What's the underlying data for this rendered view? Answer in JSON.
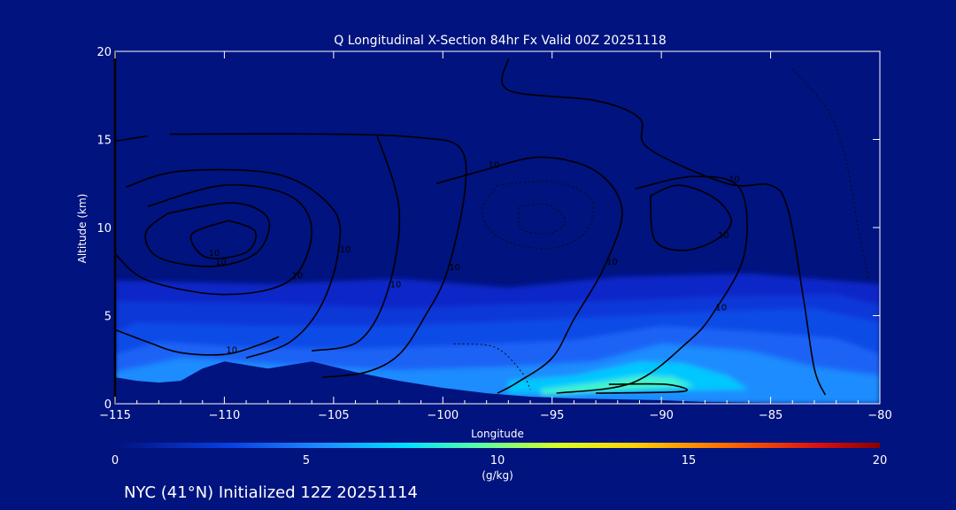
{
  "chart_data": {
    "type": "heatmap",
    "title": "Q Longitudinal X-Section 84hr  Fx Valid 00Z 20251118",
    "xlabel": "Longitude",
    "ylabel": "Altitude (km)",
    "xlim": [
      -115,
      -80
    ],
    "ylim": [
      0,
      20
    ],
    "x_ticks": [
      -115,
      -110,
      -105,
      -100,
      -95,
      -90,
      -85,
      -80
    ],
    "x_tick_labels": [
      "−115",
      "−110",
      "−105",
      "−100",
      "−95",
      "−90",
      "−85",
      "−80"
    ],
    "y_ticks": [
      0,
      5,
      10,
      15,
      20
    ],
    "y_tick_labels": [
      "0",
      "5",
      "10",
      "15",
      "20"
    ],
    "grid": false,
    "colorbar": {
      "min": 0,
      "max": 20,
      "ticks": [
        0,
        5,
        10,
        15,
        20
      ],
      "tick_labels": [
        "0",
        "5",
        "10",
        "15",
        "20"
      ],
      "unit_label": "(g/kg)"
    },
    "fill_regions": [
      {
        "q": 1.5,
        "points": [
          [
            -115,
            7
          ],
          [
            -108,
            6.8
          ],
          [
            -102,
            7.1
          ],
          [
            -97,
            6.6
          ],
          [
            -92,
            7.2
          ],
          [
            -86,
            7.4
          ],
          [
            -80,
            6.8
          ],
          [
            -80,
            0
          ],
          [
            -115,
            0
          ]
        ]
      },
      {
        "q": 2.5,
        "points": [
          [
            -115,
            5.8
          ],
          [
            -108,
            5.7
          ],
          [
            -102,
            5.4
          ],
          [
            -98,
            5.6
          ],
          [
            -93,
            5.8
          ],
          [
            -87,
            6.1
          ],
          [
            -82,
            6.2
          ],
          [
            -80,
            5.6
          ],
          [
            -80,
            0
          ],
          [
            -115,
            0
          ]
        ]
      },
      {
        "q": 3.5,
        "points": [
          [
            -114,
            4.6
          ],
          [
            -108,
            4.4
          ],
          [
            -103,
            4.4
          ],
          [
            -98,
            4.6
          ],
          [
            -93,
            4.9
          ],
          [
            -88,
            5.2
          ],
          [
            -83,
            5.4
          ],
          [
            -80,
            4.6
          ],
          [
            -80,
            0
          ],
          [
            -115,
            0
          ],
          [
            -115,
            4
          ]
        ]
      },
      {
        "q": 4.5,
        "points": [
          [
            -113,
            3.5
          ],
          [
            -109,
            3.2
          ],
          [
            -104,
            3.1
          ],
          [
            -99,
            3.3
          ],
          [
            -94,
            3.6
          ],
          [
            -90,
            4.4
          ],
          [
            -86,
            4.1
          ],
          [
            -82,
            3.7
          ],
          [
            -80,
            2.8
          ],
          [
            -80,
            0
          ],
          [
            -115,
            0
          ],
          [
            -115,
            2.8
          ]
        ]
      },
      {
        "q": 5.5,
        "points": [
          [
            -112,
            2.6
          ],
          [
            -107,
            2.2
          ],
          [
            -102,
            1.9
          ],
          [
            -97,
            2.1
          ],
          [
            -93,
            2.4
          ],
          [
            -90,
            3.4
          ],
          [
            -86,
            3.0
          ],
          [
            -83,
            2.1
          ],
          [
            -80,
            1.6
          ],
          [
            -80,
            0
          ],
          [
            -115,
            0
          ],
          [
            -115,
            1.8
          ]
        ]
      },
      {
        "q": 7,
        "points": [
          [
            -97,
            1.3
          ],
          [
            -94,
            1.6
          ],
          [
            -91,
            2.4
          ],
          [
            -89,
            2.3
          ],
          [
            -87,
            1.6
          ],
          [
            -86,
            0.8
          ],
          [
            -97,
            0.6
          ]
        ]
      },
      {
        "q": 9,
        "points": [
          [
            -95.5,
            0.8
          ],
          [
            -93,
            1.2
          ],
          [
            -91,
            1.6
          ],
          [
            -89.5,
            1.5
          ],
          [
            -88.5,
            1.0
          ],
          [
            -95.5,
            0.5
          ]
        ]
      }
    ],
    "terrain": [
      [
        -115,
        1.5
      ],
      [
        -114,
        1.3
      ],
      [
        -113,
        1.2
      ],
      [
        -112,
        1.3
      ],
      [
        -111,
        2.0
      ],
      [
        -110,
        2.4
      ],
      [
        -109,
        2.2
      ],
      [
        -108,
        2.0
      ],
      [
        -107,
        2.2
      ],
      [
        -106,
        2.4
      ],
      [
        -105,
        2.1
      ],
      [
        -104,
        1.8
      ],
      [
        -102,
        1.3
      ],
      [
        -100,
        0.9
      ],
      [
        -98,
        0.6
      ],
      [
        -96,
        0.4
      ],
      [
        -94,
        0.3
      ],
      [
        -92,
        0.25
      ],
      [
        -90,
        0.2
      ],
      [
        -88,
        0.1
      ],
      [
        -85,
        0.05
      ],
      [
        -80,
        0
      ]
    ],
    "contours": [
      {
        "label": "10",
        "points": [
          [
            -112.5,
            15.3
          ],
          [
            -105,
            15.3
          ],
          [
            -101,
            15.1
          ],
          [
            -99.2,
            14.5
          ],
          [
            -99,
            12
          ],
          [
            -99.8,
            7.5
          ],
          [
            -100.8,
            5
          ],
          [
            -102,
            2.8
          ],
          [
            -103.5,
            1.8
          ],
          [
            -105.5,
            1.5
          ]
        ]
      },
      {
        "label": "",
        "points": [
          [
            -115,
            14.9
          ],
          [
            -113.5,
            15.2
          ]
        ]
      },
      {
        "label": "10",
        "points": [
          [
            -114.5,
            12.3
          ],
          [
            -112,
            13.2
          ],
          [
            -107.5,
            13.0
          ],
          [
            -105,
            11.0
          ],
          [
            -104.8,
            8.5
          ],
          [
            -105.6,
            5.5
          ],
          [
            -107,
            3.5
          ],
          [
            -109,
            2.6
          ]
        ]
      },
      {
        "label": "10",
        "points": [
          [
            -113.5,
            11.2
          ],
          [
            -110,
            12.4
          ],
          [
            -107,
            11.8
          ],
          [
            -106,
            9.8
          ],
          [
            -107,
            7.0
          ],
          [
            -110,
            6.2
          ],
          [
            -113.5,
            7.0
          ],
          [
            -115,
            8.5
          ]
        ]
      },
      {
        "label": "10",
        "points": [
          [
            -112.6,
            10.8
          ],
          [
            -109.6,
            11.4
          ],
          [
            -108,
            10.5
          ],
          [
            -108.5,
            8.6
          ],
          [
            -110.5,
            7.8
          ],
          [
            -113,
            8.3
          ],
          [
            -113.6,
            9.7
          ],
          [
            -112.6,
            10.8
          ]
        ]
      },
      {
        "label": "10",
        "points": [
          [
            -109.8,
            10.4
          ],
          [
            -108.6,
            9.8
          ],
          [
            -109,
            8.6
          ],
          [
            -110.8,
            8.3
          ],
          [
            -111.5,
            9.6
          ],
          [
            -109.8,
            10.4
          ]
        ]
      },
      {
        "label": "10",
        "points": [
          [
            -103,
            15.2
          ],
          [
            -102,
            11
          ],
          [
            -102.5,
            6.5
          ],
          [
            -103.8,
            3.6
          ],
          [
            -106,
            3.0
          ]
        ]
      },
      {
        "label": "10",
        "points": [
          [
            -98,
            13.3
          ],
          [
            -95.5,
            14.0
          ],
          [
            -93,
            13.2
          ],
          [
            -91.8,
            11
          ],
          [
            -92.6,
            7.8
          ],
          [
            -94,
            4.8
          ],
          [
            -95,
            2.6
          ],
          [
            -96.6,
            1.2
          ],
          [
            -97.5,
            0.6
          ]
        ]
      },
      {
        "label": "10",
        "points": [
          [
            -100.3,
            12.5
          ],
          [
            -98,
            13.3
          ]
        ]
      },
      {
        "label": "10",
        "points": [
          [
            -97,
            19.6
          ],
          [
            -97,
            17.8
          ],
          [
            -93,
            17.2
          ],
          [
            -91,
            16.2
          ],
          [
            -90.6,
            14.5
          ],
          [
            -87,
            12.5
          ],
          [
            -85,
            12.4
          ],
          [
            -84.2,
            11
          ],
          [
            -83.5,
            6
          ],
          [
            -83,
            2
          ],
          [
            -82.5,
            0.5
          ]
        ]
      },
      {
        "label": "10",
        "points": [
          [
            -90.5,
            11.8
          ],
          [
            -89.2,
            12.4
          ],
          [
            -87.6,
            11.7
          ],
          [
            -86.8,
            10.4
          ],
          [
            -87.5,
            9.3
          ],
          [
            -89,
            8.7
          ],
          [
            -90.3,
            9.3
          ],
          [
            -90.5,
            11.8
          ]
        ]
      },
      {
        "label": "10",
        "points": [
          [
            -91.2,
            12.2
          ],
          [
            -88.5,
            12.9
          ],
          [
            -86.4,
            12.2
          ],
          [
            -86.2,
            8.5
          ],
          [
            -87.6,
            5.2
          ],
          [
            -88.8,
            3.5
          ],
          [
            -91.3,
            1.2
          ],
          [
            -94.8,
            0.6
          ]
        ]
      },
      {
        "label": "",
        "points": [
          [
            -92.4,
            1.1
          ],
          [
            -89.8,
            1.1
          ],
          [
            -89,
            0.7
          ],
          [
            -93,
            0.6
          ]
        ]
      },
      {
        "label": "10",
        "points": [
          [
            -115,
            4.2
          ],
          [
            -113.5,
            3.5
          ],
          [
            -112,
            2.9
          ],
          [
            -110,
            2.8
          ],
          [
            -108.5,
            3.3
          ],
          [
            -107.5,
            3.8
          ]
        ]
      }
    ],
    "dotted_contours": [
      {
        "points": [
          [
            -97.5,
            12.4
          ],
          [
            -95,
            12.6
          ],
          [
            -93.2,
            11.6
          ],
          [
            -93.5,
            9.7
          ],
          [
            -95.2,
            8.8
          ],
          [
            -97.4,
            9.4
          ],
          [
            -98.2,
            10.9
          ],
          [
            -97.5,
            12.4
          ]
        ]
      },
      {
        "points": [
          [
            -96.5,
            11.2
          ],
          [
            -95.2,
            11.3
          ],
          [
            -94.4,
            10.4
          ],
          [
            -95,
            9.7
          ],
          [
            -96.4,
            9.9
          ],
          [
            -96.5,
            11.2
          ]
        ]
      },
      {
        "points": [
          [
            -84,
            19
          ],
          [
            -82.3,
            16.5
          ],
          [
            -81.5,
            13.5
          ],
          [
            -81,
            10
          ],
          [
            -80.5,
            7
          ]
        ]
      },
      {
        "points": [
          [
            -99.5,
            3.4
          ],
          [
            -97.6,
            3.2
          ],
          [
            -96.4,
            1.8
          ],
          [
            -96,
            0.8
          ]
        ]
      }
    ],
    "footer": "NYC (41°N) Initialized 12Z 20251114"
  }
}
